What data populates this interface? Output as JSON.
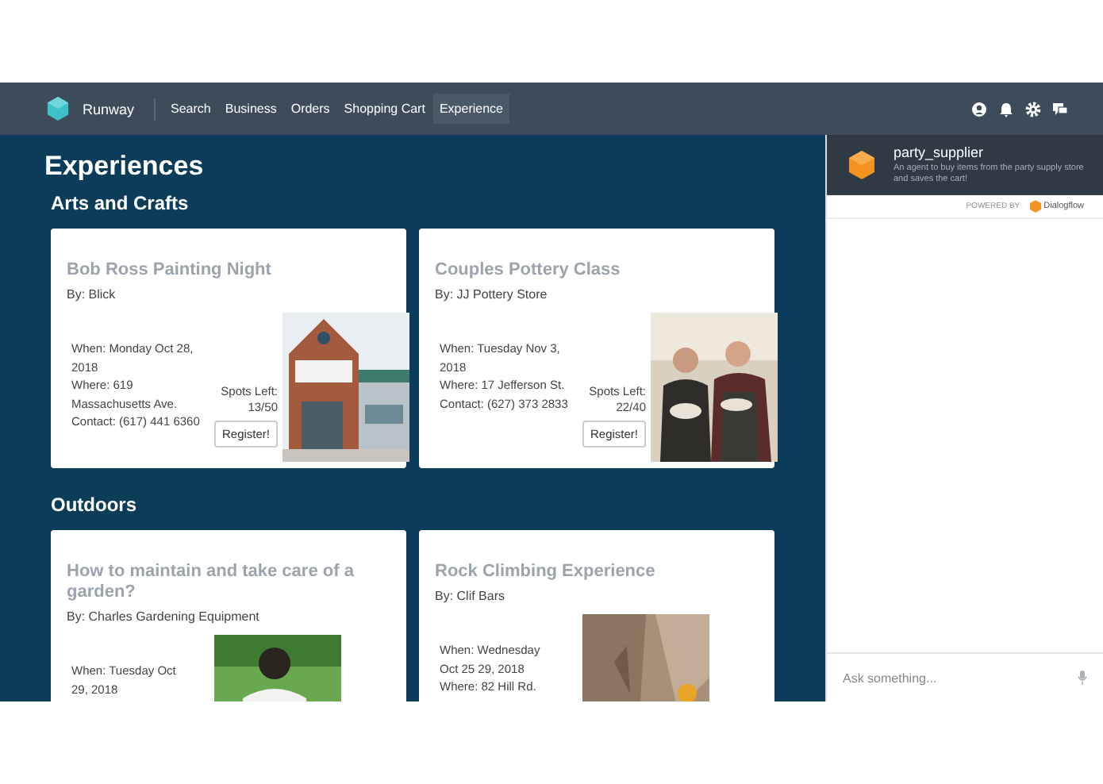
{
  "nav": {
    "brand": "Runway",
    "items": [
      {
        "label": "Search",
        "selected": false
      },
      {
        "label": "Business",
        "selected": false
      },
      {
        "label": "Orders",
        "selected": false
      },
      {
        "label": "Shopping Cart",
        "selected": false
      },
      {
        "label": "Experience",
        "selected": true
      }
    ]
  },
  "page_title": "Experiences",
  "sections": [
    {
      "heading": "Arts and Crafts",
      "cards": [
        {
          "title": "Bob Ross Painting Night",
          "by": "By: Blick",
          "details": [
            "When: Monday Oct 28,",
            "2018",
            "Where: 619",
            "Massachusetts Ave.",
            "Contact: (617) 441 6360"
          ],
          "spots_label": "Spots Left:",
          "spots": "13/50",
          "button": "Register!",
          "photo": {
            "kind": "picture"
          }
        },
        {
          "title": "Couples Pottery Class",
          "by": "By: JJ Pottery Store",
          "details": [
            "When: Tuesday Nov 3,",
            "2018",
            "Where: 17 Jefferson St.",
            "Contact: (627) 373 2833"
          ],
          "spots_label": "Spots Left:",
          "spots": "22/40",
          "button": "Register!",
          "photo": {
            "kind": "picture"
          }
        }
      ]
    },
    {
      "heading": "Outdoors",
      "cards": [
        {
          "title": "How to maintain and take care of a garden?",
          "by": "By: Charles Gardening Equipment",
          "details": [
            "When: Tuesday Oct",
            "29, 2018"
          ],
          "photo": {
            "kind": "picture"
          }
        },
        {
          "title": "Rock Climbing Experience",
          "by": "By: Clif Bars",
          "details": [
            "When: Wednesday",
            "Oct 25 29, 2018",
            "Where: 82 Hill Rd."
          ],
          "photo": {
            "kind": "picture"
          }
        }
      ]
    }
  ],
  "chat": {
    "agent": "party_supplier",
    "description": "An agent to buy items from the party supply store and saves the cart!",
    "powered_by": "POWERED BY",
    "provider": "Dialogflow",
    "input": {
      "placeholder": "Ask something..."
    }
  }
}
